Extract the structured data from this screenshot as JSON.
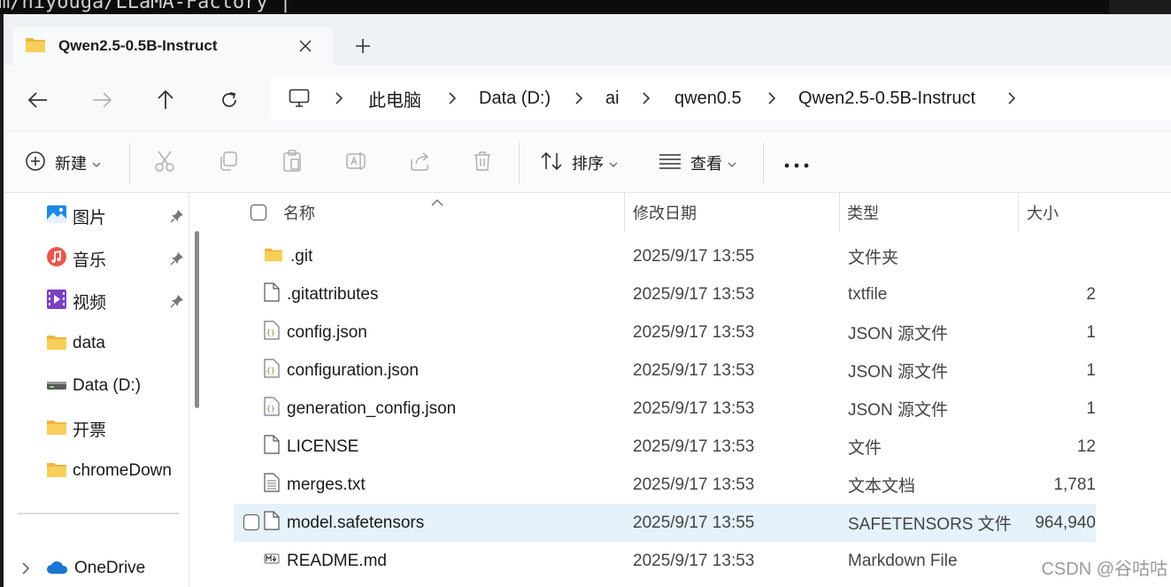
{
  "terminal": {
    "text": "m/hiyouga/LLaMA-Factory |"
  },
  "tab": {
    "title": "Qwen2.5-0.5B-Instruct"
  },
  "breadcrumbs": [
    "此电脑",
    "Data (D:)",
    "ai",
    "qwen0.5",
    "Qwen2.5-0.5B-Instruct"
  ],
  "toolbar": {
    "new_label": "新建",
    "sort_label": "排序",
    "view_label": "查看"
  },
  "sidebar": {
    "items": [
      {
        "label": "图片",
        "icon": "pictures-icon",
        "pinned": true
      },
      {
        "label": "音乐",
        "icon": "music-icon",
        "pinned": true
      },
      {
        "label": "视频",
        "icon": "videos-icon",
        "pinned": true
      },
      {
        "label": "data",
        "icon": "folder-icon",
        "pinned": false
      },
      {
        "label": "Data (D:)",
        "icon": "drive-icon",
        "pinned": false
      },
      {
        "label": "开票",
        "icon": "folder-icon",
        "pinned": false
      },
      {
        "label": "chromeDown",
        "icon": "folder-icon",
        "pinned": false
      }
    ],
    "onedrive_label": "OneDrive"
  },
  "columns": {
    "name": "名称",
    "date": "修改日期",
    "type": "类型",
    "size": "大小"
  },
  "files": [
    {
      "name": ".git",
      "date": "2025/9/17 13:55",
      "type": "文件夹",
      "size": "",
      "icon": "folder-icon"
    },
    {
      "name": ".gitattributes",
      "date": "2025/9/17 13:53",
      "type": "txtfile",
      "size": "2",
      "icon": "file-icon"
    },
    {
      "name": "config.json",
      "date": "2025/9/17 13:53",
      "type": "JSON 源文件",
      "size": "1",
      "icon": "json-file-icon"
    },
    {
      "name": "configuration.json",
      "date": "2025/9/17 13:53",
      "type": "JSON 源文件",
      "size": "1",
      "icon": "json-file-icon"
    },
    {
      "name": "generation_config.json",
      "date": "2025/9/17 13:53",
      "type": "JSON 源文件",
      "size": "1",
      "icon": "json-file-icon"
    },
    {
      "name": "LICENSE",
      "date": "2025/9/17 13:53",
      "type": "文件",
      "size": "12",
      "icon": "file-icon"
    },
    {
      "name": "merges.txt",
      "date": "2025/9/17 13:53",
      "type": "文本文档",
      "size": "1,781",
      "icon": "text-file-icon"
    },
    {
      "name": "model.safetensors",
      "date": "2025/9/17 13:55",
      "type": "SAFETENSORS 文件",
      "size": "964,940",
      "icon": "file-icon",
      "selected": true
    },
    {
      "name": "README.md",
      "date": "2025/9/17 13:53",
      "type": "Markdown File",
      "size": "",
      "icon": "markdown-file-icon"
    }
  ],
  "watermark": "CSDN @谷咕咕",
  "colors": {
    "accent": "#0067c0",
    "selection": "#e5f1fb",
    "folder": "#f4c542"
  }
}
